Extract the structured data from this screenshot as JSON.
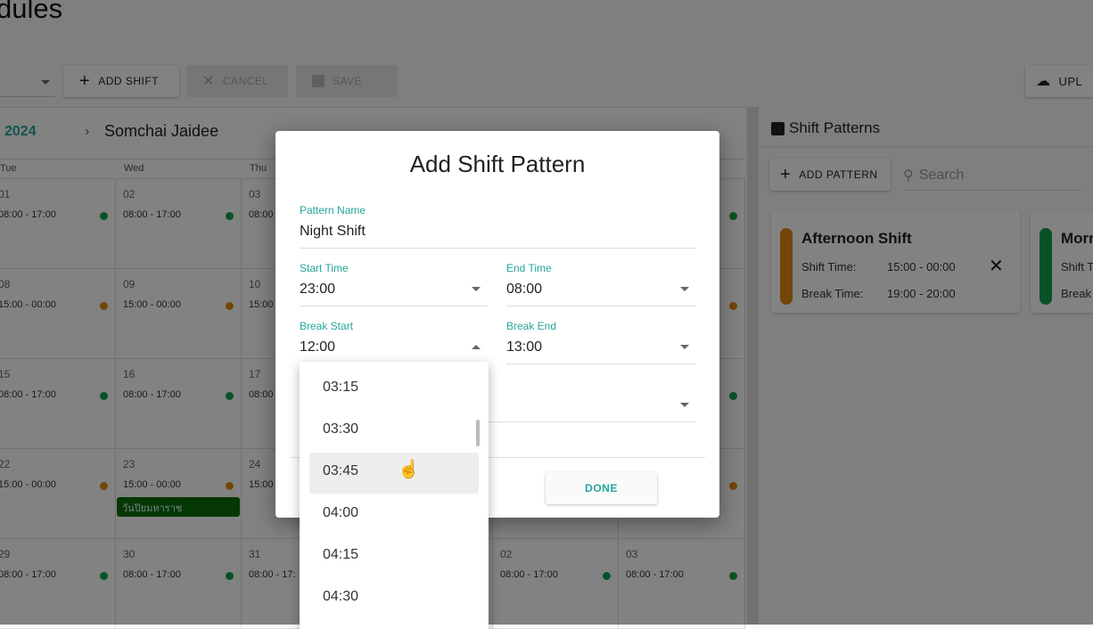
{
  "page": {
    "title": "dules"
  },
  "toolbar": {
    "add_shift": "ADD SHIFT",
    "cancel": "CANCEL",
    "save": "SAVE",
    "upload": "UPL"
  },
  "calendar": {
    "month": "2024",
    "employee": "Somchai Jaidee",
    "days": [
      "Tue",
      "Wed",
      "Thu"
    ],
    "rows": [
      [
        {
          "d": "01",
          "t": "08:00 - 17:00",
          "c": "green"
        },
        {
          "d": "02",
          "t": "08:00 - 17:00",
          "c": "green"
        },
        {
          "d": "03",
          "t": "08:00",
          "c": ""
        }
      ],
      [
        {
          "d": "08",
          "t": "15:00 - 00:00",
          "c": "orange"
        },
        {
          "d": "09",
          "t": "15:00 - 00:00",
          "c": "orange"
        },
        {
          "d": "10",
          "t": "15:00",
          "c": ""
        }
      ],
      [
        {
          "d": "15",
          "t": "08:00 - 17:00",
          "c": "green"
        },
        {
          "d": "16",
          "t": "08:00 - 17:00",
          "c": "green"
        },
        {
          "d": "17",
          "t": "08:00",
          "c": ""
        }
      ],
      [
        {
          "d": "22",
          "t": "15:00 - 00:00",
          "c": "orange"
        },
        {
          "d": "23",
          "t": "15:00 - 00:00",
          "c": "orange",
          "holiday": "วันปิยมหาราช"
        },
        {
          "d": "24",
          "t": "15:00",
          "c": ""
        }
      ],
      [
        {
          "d": "29",
          "t": "08:00 - 17:00",
          "c": "green"
        },
        {
          "d": "30",
          "t": "08:00 - 17:00",
          "c": "green"
        },
        {
          "d": "31",
          "t": "08:00 - 17:",
          "c": ""
        }
      ]
    ],
    "sun_dots": [
      "green",
      "orange",
      "green",
      "orange"
    ],
    "last_row_right": [
      {
        "d": "02",
        "t": "08:00 - 17:00",
        "c": "green"
      },
      {
        "d": "03",
        "t": "08:00 - 17:00",
        "c": "green"
      }
    ]
  },
  "colors": {
    "green": "#12a150",
    "orange": "#e08a10",
    "accent": "#26a69a"
  },
  "panel": {
    "title": "Shift Patterns",
    "add_pattern": "ADD PATTERN",
    "search_placeholder": "Search",
    "cards": [
      {
        "name": "Afternoon Shift",
        "shift_label": "Shift Time:",
        "shift": "15:00 - 00:00",
        "break_label": "Break Time:",
        "break": "19:00 - 20:00",
        "color": "orange"
      },
      {
        "name": "Morn",
        "shift_label": "Shift T",
        "break_label": "Break",
        "color": "green"
      }
    ]
  },
  "dialog": {
    "title": "Add Shift Pattern",
    "pattern_name": {
      "label": "Pattern Name",
      "value": "Night Shift"
    },
    "start_time": {
      "label": "Start Time",
      "value": "23:00"
    },
    "end_time": {
      "label": "End Time",
      "value": "08:00"
    },
    "break_start": {
      "label": "Break Start",
      "value": "12:00"
    },
    "break_end": {
      "label": "Break End",
      "value": "13:00"
    },
    "done": "DONE"
  },
  "dropdown": {
    "options": [
      "03:15",
      "03:30",
      "03:45",
      "04:00",
      "04:15",
      "04:30"
    ],
    "hovered": "03:45"
  }
}
